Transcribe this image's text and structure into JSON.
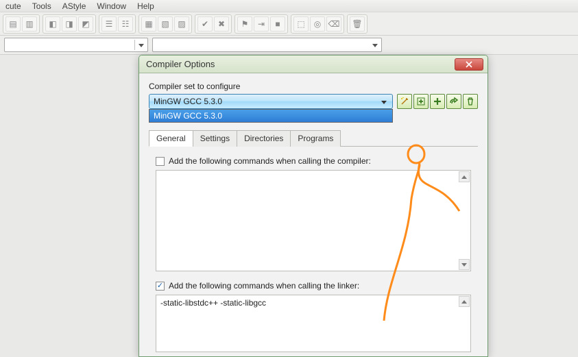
{
  "menubar": {
    "items": [
      "cute",
      "Tools",
      "AStyle",
      "Window",
      "Help"
    ]
  },
  "dialog": {
    "title": "Compiler Options",
    "config_label": "Compiler set to configure",
    "select_value": "MinGW GCC 5.3.0",
    "dropdown_item": "MinGW GCC 5.3.0",
    "tabs": [
      "General",
      "Settings",
      "Directories",
      "Programs"
    ],
    "compiler_chk": {
      "checked": false,
      "label": "Add the following commands when calling the compiler:"
    },
    "compiler_cmds": "",
    "linker_chk": {
      "checked": true,
      "label": "Add the following commands when calling the linker:"
    },
    "linker_cmds": "-static-libstdc++ -static-libgcc"
  }
}
